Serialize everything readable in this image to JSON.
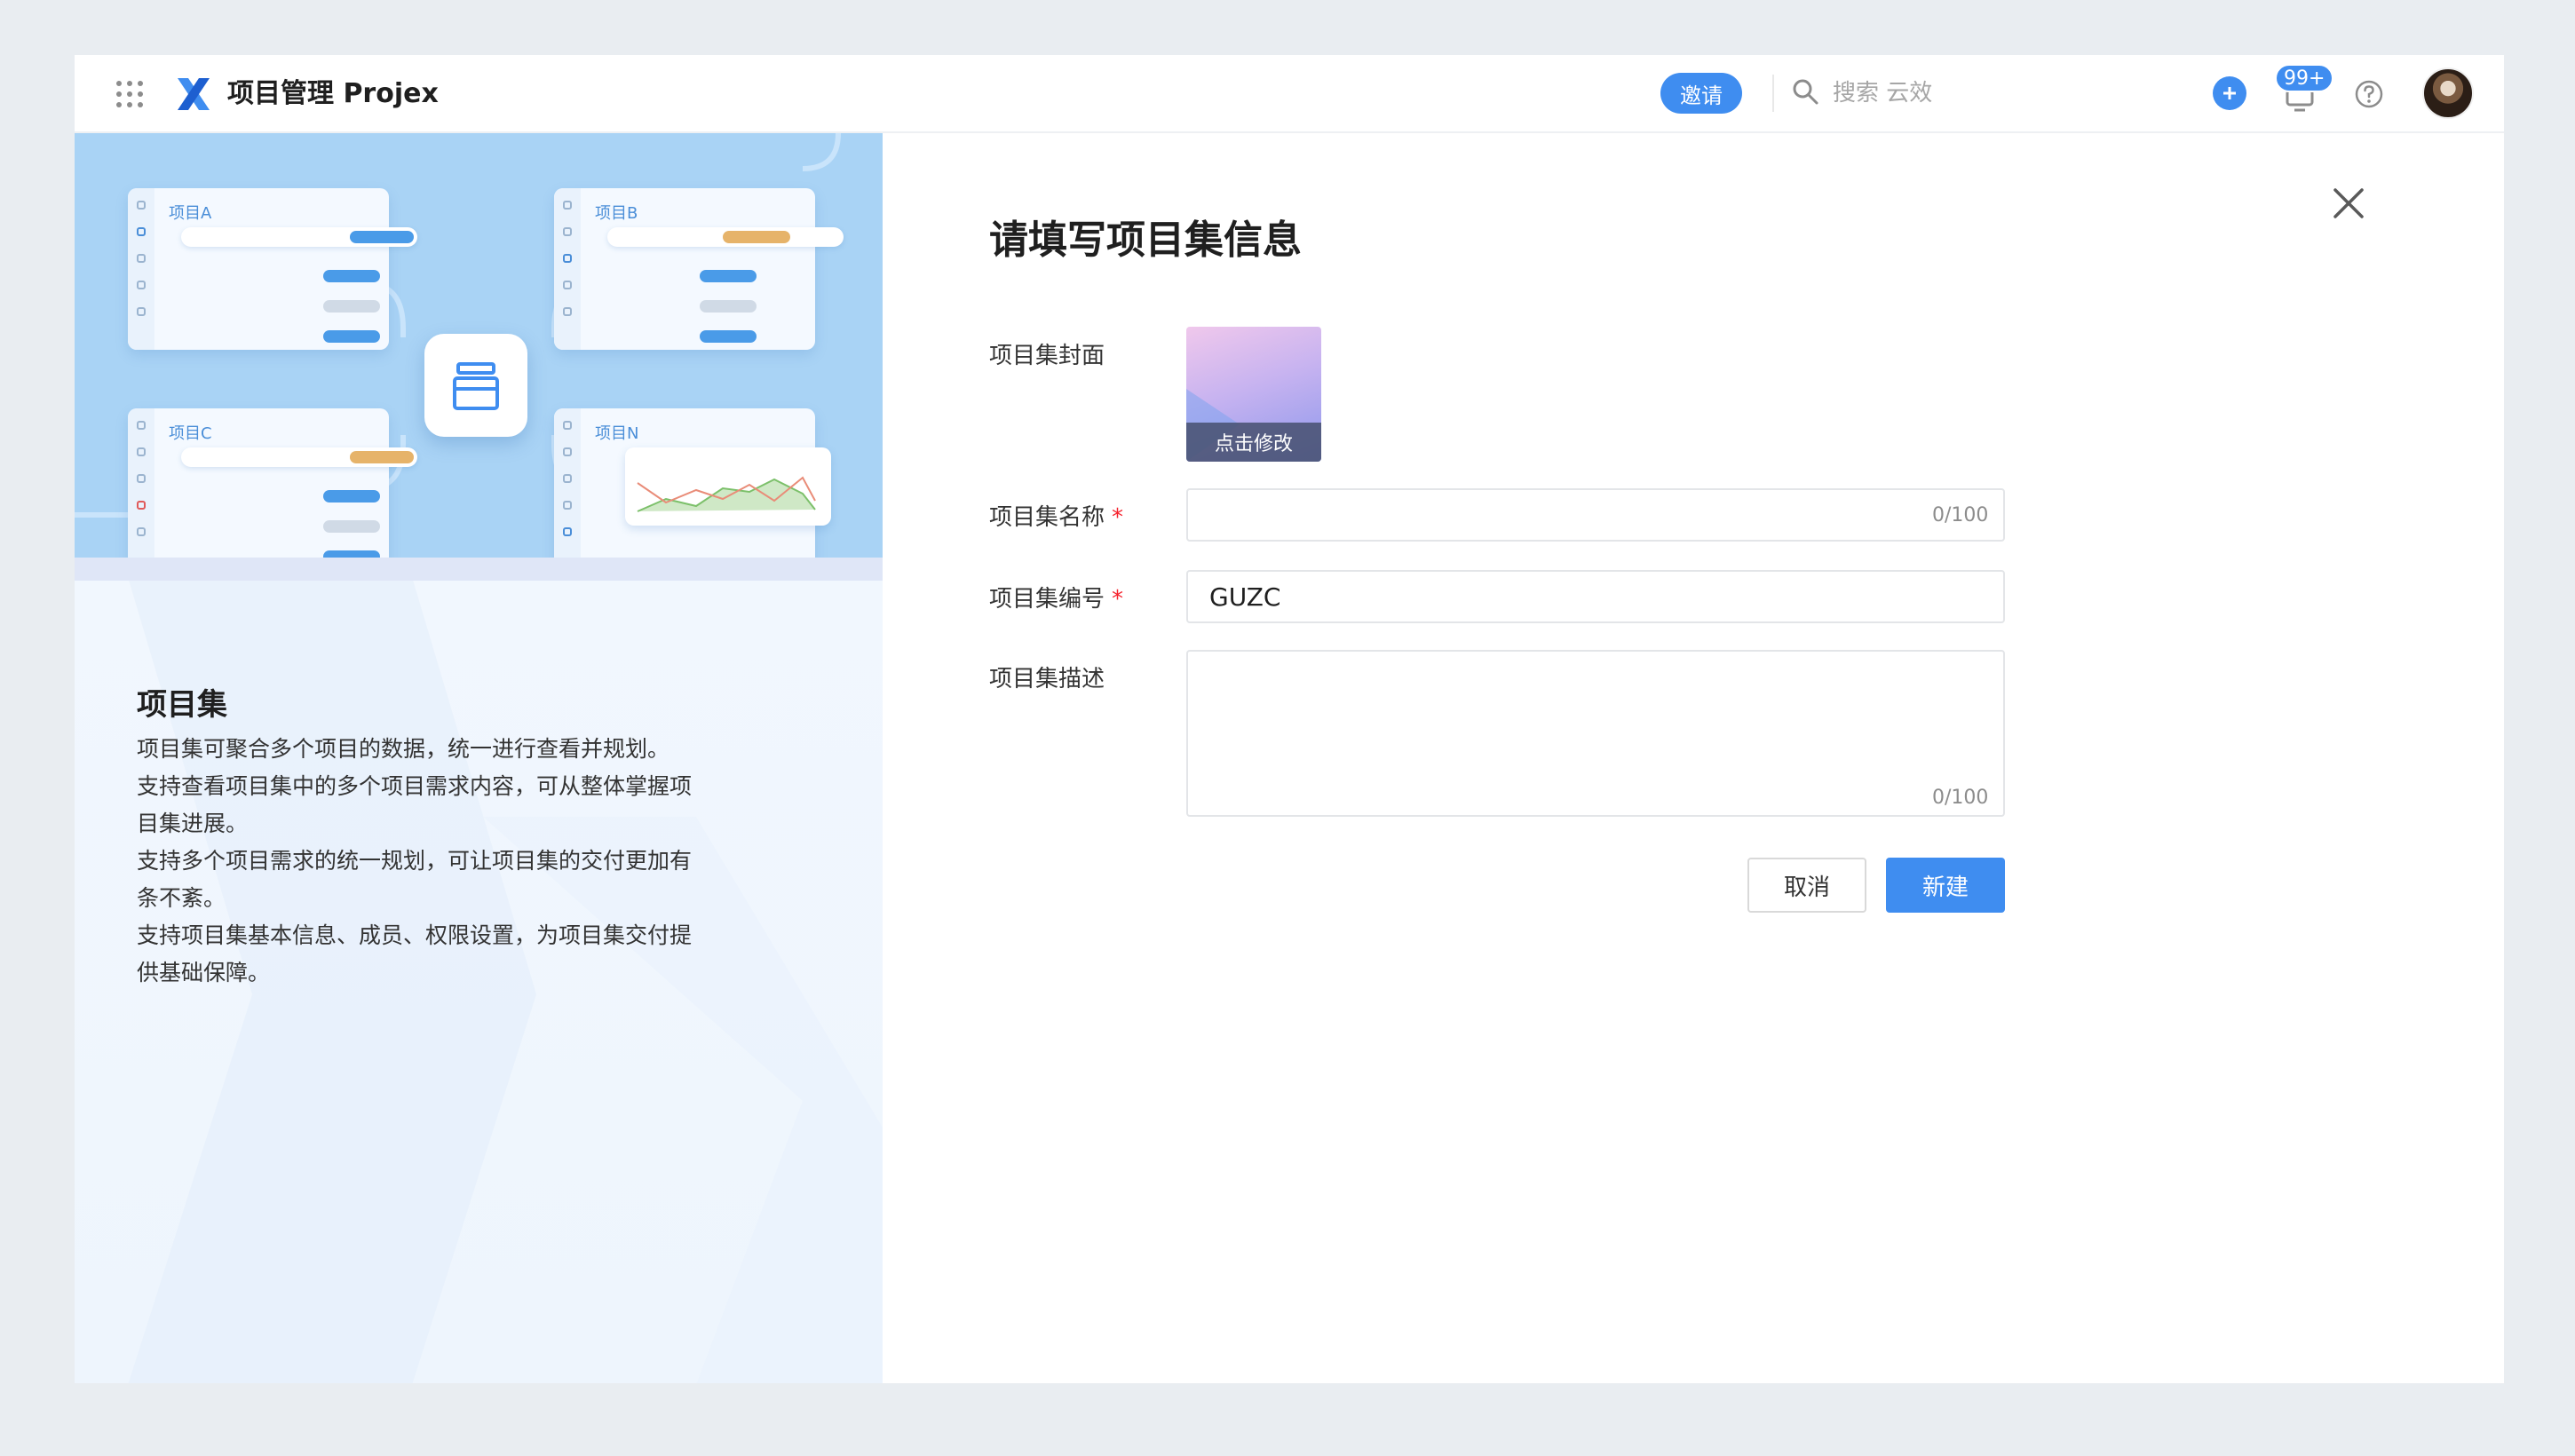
{
  "header": {
    "app_title": "项目管理 Projex",
    "invite_label": "邀请",
    "search_placeholder": "搜索 云效",
    "notification_count": "99+",
    "accent_color": "#3f8df0"
  },
  "illustration": {
    "cards": [
      "项目A",
      "项目B",
      "项目C",
      "项目N"
    ]
  },
  "info_panel": {
    "title": "项目集",
    "lines": [
      "项目集可聚合多个项目的数据，统一进行查看并规划。",
      "支持查看项目集中的多个项目需求内容，可从整体掌握项",
      "目集进展。",
      "支持多个项目需求的统一规划，可让项目集的交付更加有",
      "条不紊。",
      "支持项目集基本信息、成员、权限设置，为项目集交付提",
      "供基础保障。"
    ]
  },
  "form": {
    "title": "请填写项目集信息",
    "cover_label": "项目集封面",
    "cover_caption": "点击修改",
    "name_label": "项目集名称",
    "name_value": "",
    "name_counter": "0/100",
    "code_label": "项目集编号",
    "code_value": "GUZC",
    "desc_label": "项目集描述",
    "desc_value": "",
    "desc_counter": "0/100",
    "required_mark": "*",
    "cancel_label": "取消",
    "create_label": "新建"
  }
}
